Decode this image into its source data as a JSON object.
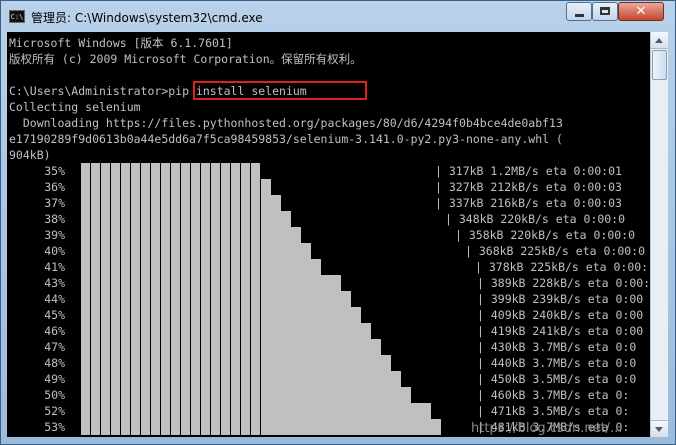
{
  "window": {
    "title": "管理员: C:\\Windows\\system32\\cmd.exe",
    "icon": "cmd-icon",
    "controls": {
      "minimize": "minimize-icon",
      "maximize": "maximize-icon",
      "close": "close-icon"
    }
  },
  "console": {
    "lines": [
      "Microsoft Windows [版本 6.1.7601]",
      "版权所有 (c) 2009 Microsoft Corporation。保留所有权利。",
      "",
      "C:\\Users\\Administrator>pip install selenium",
      "Collecting selenium",
      "  Downloading https://files.pythonhosted.org/packages/80/d6/4294f0b4bce4de0abf13",
      "e17190289f9d0613b0a44e5dd6a7f5ca98459853/selenium-3.141.0-py2.py3-none-any.whl (",
      "904kB)"
    ],
    "progress": [
      {
        "pct": "35%",
        "fraction": 0.35,
        "speed": "| 317kB 1.2MB/s eta 0:00:01"
      },
      {
        "pct": "36%",
        "fraction": 0.36,
        "speed": "| 327kB 212kB/s eta 0:00:03"
      },
      {
        "pct": "37%",
        "fraction": 0.37,
        "speed": "| 337kB 216kB/s eta 0:00:03"
      },
      {
        "pct": "38%",
        "fraction": 0.38,
        "speed": "| 348kB 220kB/s eta 0:00:0"
      },
      {
        "pct": "39%",
        "fraction": 0.39,
        "speed": "| 358kB 220kB/s eta 0:00:0"
      },
      {
        "pct": "40%",
        "fraction": 0.4,
        "speed": "| 368kB 225kB/s eta 0:00:0"
      },
      {
        "pct": "41%",
        "fraction": 0.41,
        "speed": "| 378kB 225kB/s eta 0:00:"
      },
      {
        "pct": "43%",
        "fraction": 0.43,
        "speed": "| 389kB 228kB/s eta 0:00:"
      },
      {
        "pct": "44%",
        "fraction": 0.44,
        "speed": "| 399kB 239kB/s eta 0:00"
      },
      {
        "pct": "45%",
        "fraction": 0.45,
        "speed": "| 409kB 240kB/s eta 0:00"
      },
      {
        "pct": "46%",
        "fraction": 0.46,
        "speed": "| 419kB 241kB/s eta 0:00"
      },
      {
        "pct": "47%",
        "fraction": 0.47,
        "speed": "| 430kB 3.7MB/s eta 0:0"
      },
      {
        "pct": "48%",
        "fraction": 0.48,
        "speed": "| 440kB 3.7MB/s eta 0:0"
      },
      {
        "pct": "49%",
        "fraction": 0.49,
        "speed": "| 450kB 3.5MB/s eta 0:0"
      },
      {
        "pct": "50%",
        "fraction": 0.5,
        "speed": "| 460kB 3.7MB/s eta 0:"
      },
      {
        "pct": "52%",
        "fraction": 0.52,
        "speed": "| 471kB 3.5MB/s eta 0:"
      },
      {
        "pct": "53%",
        "fraction": 0.53,
        "speed": "| 481kB 3.7MB/s eta 0:"
      }
    ]
  },
  "watermark": "https://blog.csdn.net/..."
}
